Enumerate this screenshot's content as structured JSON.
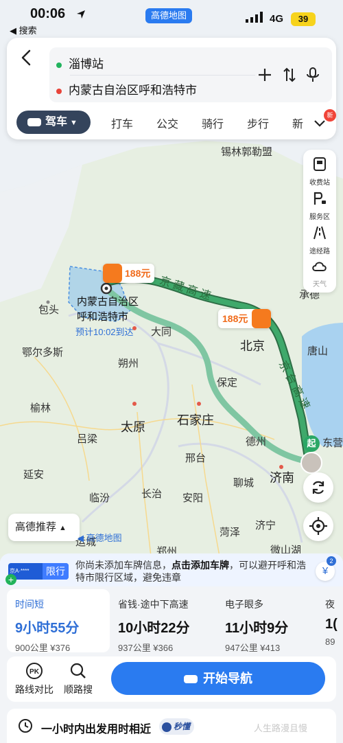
{
  "status_bar": {
    "time": "00:06",
    "back_app": "◀ 搜索",
    "app_badge": "高德地图",
    "network": "4G",
    "battery": "39"
  },
  "search": {
    "origin": "淄博站",
    "destination": "内蒙古自治区呼和浩特市",
    "origin_color": "#22b35e",
    "destination_color": "#e8443a"
  },
  "modes": {
    "selected": "驾车",
    "tabs": [
      "打车",
      "公交",
      "骑行",
      "步行",
      "新"
    ],
    "new_badge": "新"
  },
  "side_panel": {
    "items": [
      {
        "label": "收费站",
        "icon": "toll-station-icon"
      },
      {
        "label": "服务区",
        "icon": "service-area-icon"
      },
      {
        "label": "途经路",
        "icon": "via-road-icon"
      },
      {
        "label": "天气",
        "icon": "weather-icon"
      }
    ]
  },
  "map": {
    "cities": {
      "xilin": "锡林郭勒盟",
      "baotou": "包头",
      "huhehaote_line1": "内蒙古自治区",
      "huhehaote_line2": "呼和浩特市",
      "eta": "预计10:02到达",
      "datong": "大同",
      "beijing": "北京",
      "chengde": "承德",
      "tangshan": "唐山",
      "ordos": "鄂尔多斯",
      "shuozhou": "朔州",
      "baoding": "保定",
      "yulin": "榆林",
      "taiyuan": "太原",
      "shijiazhuang": "石家庄",
      "dezhou": "德州",
      "dongying": "东营",
      "lvliang": "吕梁",
      "xingtai": "邢台",
      "yanan": "延安",
      "jinan": "济南",
      "linfen": "临汾",
      "changzhi": "长治",
      "anyang": "安阳",
      "liaocheng": "聊城",
      "heze": "菏泽",
      "jining": "济宁",
      "yuncheng": "运城",
      "zhengzhou": "郑州",
      "weishan": "微山湖",
      "start_marker": "起"
    },
    "highway_labels": {
      "jingzang": "京 藏 高 速",
      "jinghu": "京 台 高 速"
    },
    "tolls": [
      "188元",
      "188元"
    ],
    "recommend": "高德推荐",
    "amap_logo": "◀ 高德地图"
  },
  "sheet": {
    "plate_text": "京A·****",
    "plate_limit": "限行",
    "plate_msg_pre": "你尚未添加车牌信息，",
    "plate_msg_bold": "点击添加车牌",
    "plate_msg_post": "，可以避开呼和浩特市限行区域，避免违章",
    "coin_label": "¥",
    "coin_badge": "2",
    "routes": [
      {
        "tag": "时间短",
        "duration": "9小时55分",
        "meta": "900公里  ¥376"
      },
      {
        "tag": "省钱·途中下高速",
        "duration": "10小时22分",
        "meta": "937公里  ¥366"
      },
      {
        "tag": "电子眼多",
        "duration": "11小时9分",
        "meta": "947公里  ¥413"
      },
      {
        "tag": "夜",
        "duration": "1(",
        "meta": "89"
      }
    ],
    "compare_label": "路线对比",
    "along_label": "顺路搜",
    "nav_label": "开始导航",
    "depart_text": "一小时内出发用时相近",
    "miaodong": "秒懂",
    "watermark": "人生路漫且慢"
  },
  "colors": {
    "accent": "#2a7bf0",
    "route_main": "#2f8f5b",
    "route_alt": "#6cbf9a",
    "toll": "#f57a1e"
  }
}
